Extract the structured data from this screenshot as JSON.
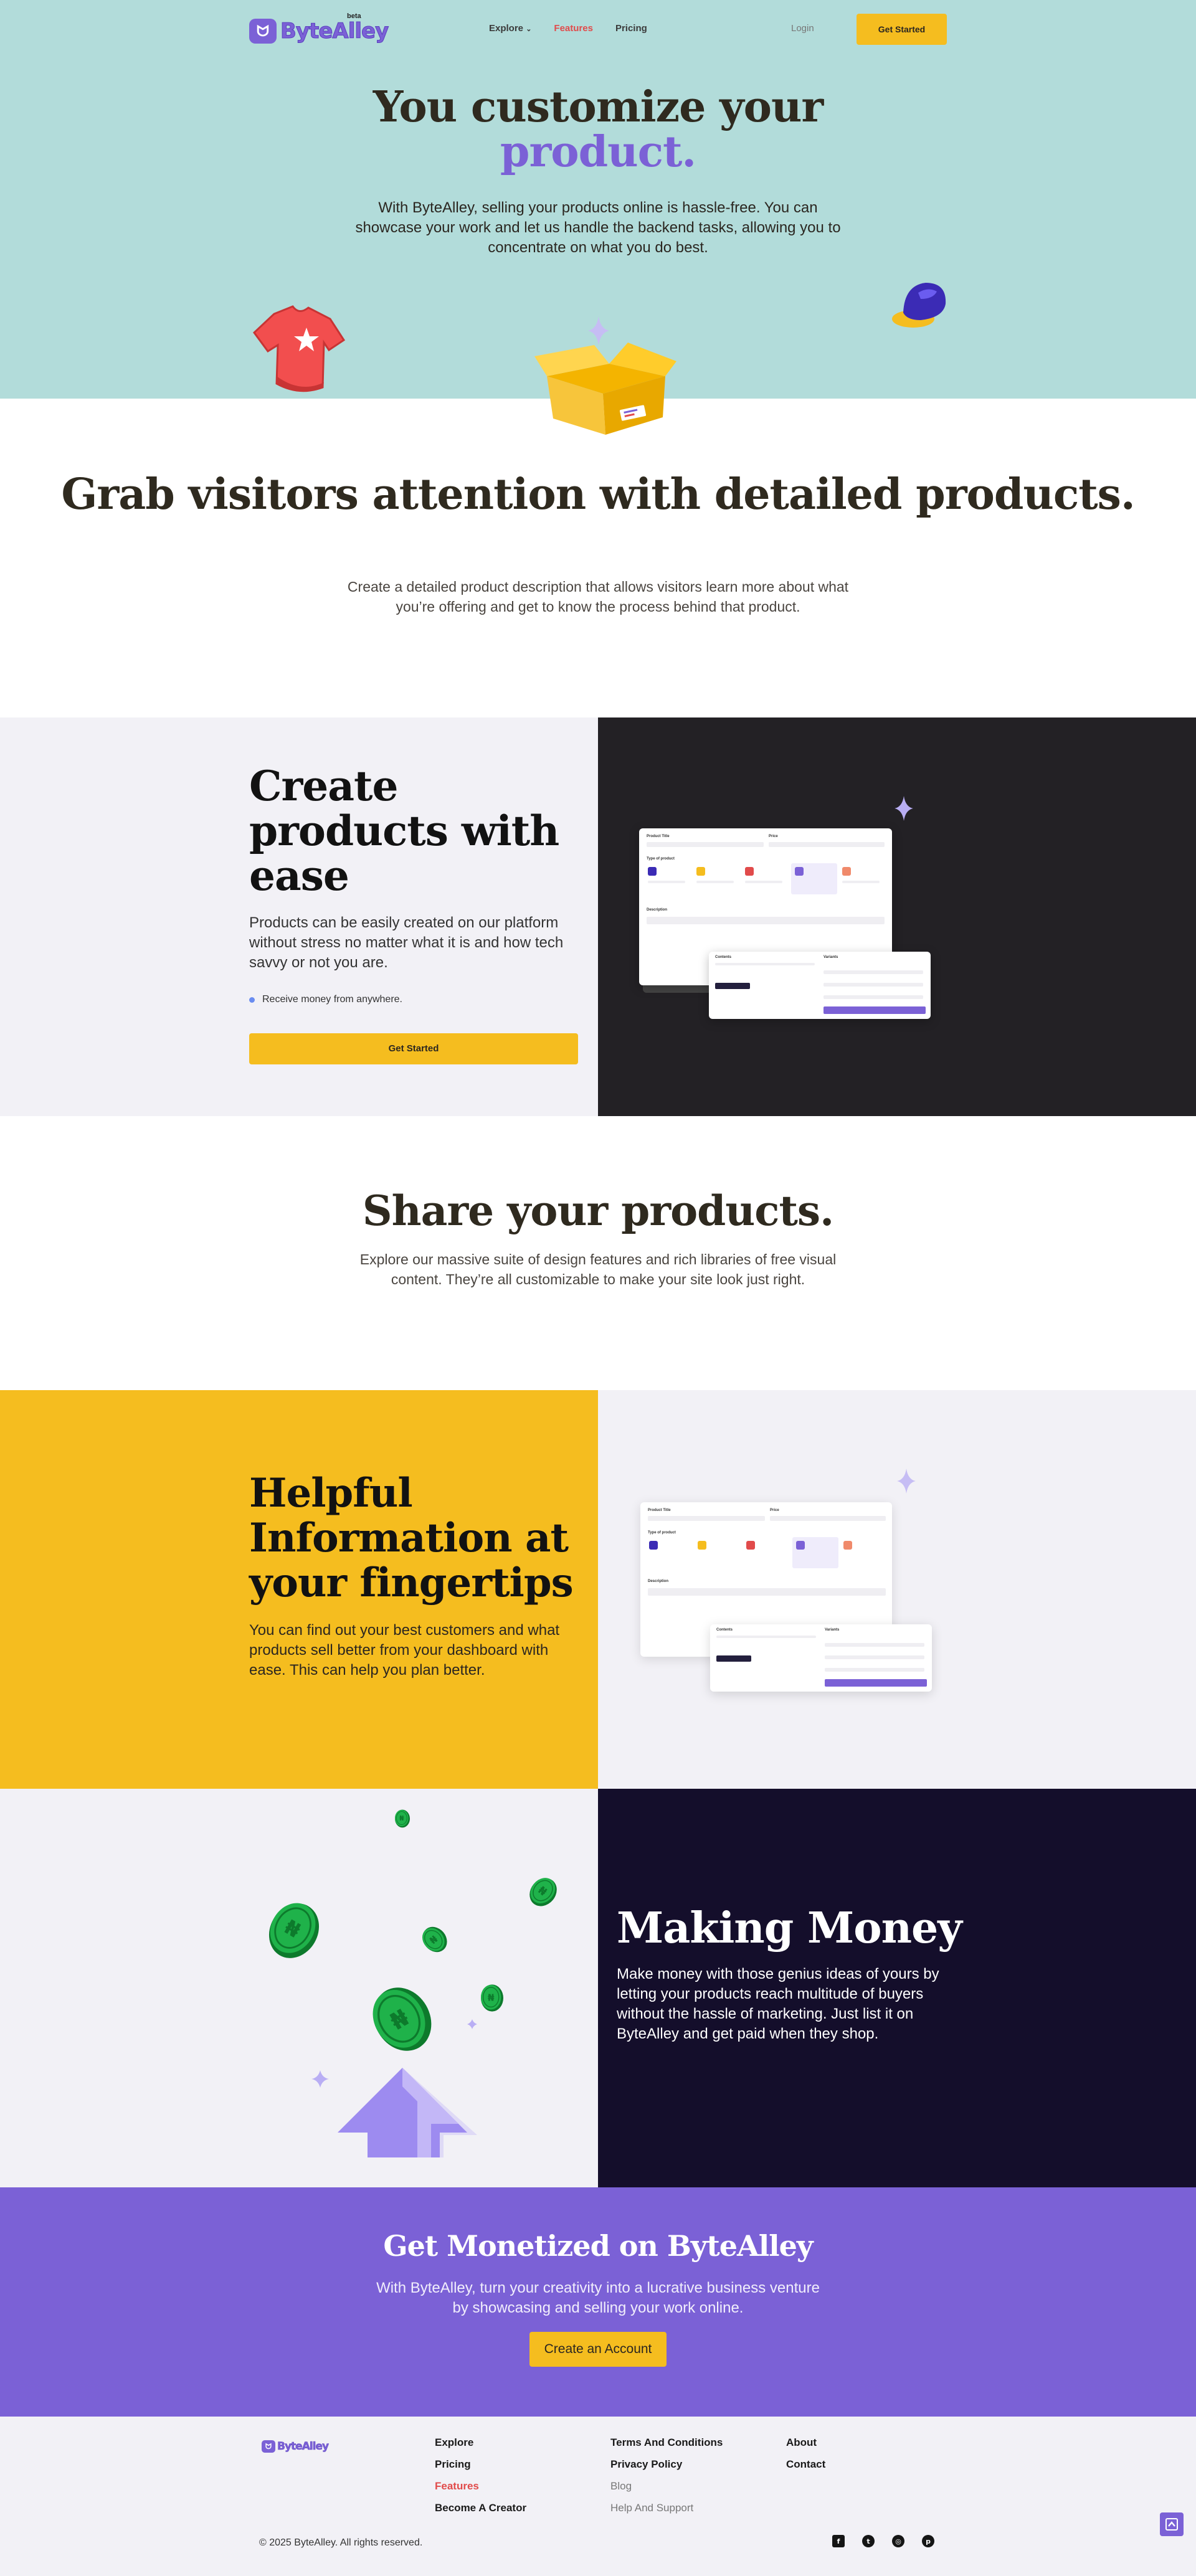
{
  "nav": {
    "logo_text": "ByteAlley",
    "beta": "beta",
    "links": [
      {
        "label": "Explore",
        "chevron": true
      },
      {
        "label": "Features",
        "active": true
      },
      {
        "label": "Pricing"
      }
    ],
    "login": "Login",
    "cta": "Get Started"
  },
  "hero": {
    "title_line1": "You customize your",
    "title_line2": "product.",
    "subtitle": "With ByteAlley, selling your products online is hassle-free. You can showcase your work and let us handle the backend tasks, allowing you to concentrate on what you do best."
  },
  "grab": {
    "title": "Grab visitors attention with detailed products.",
    "subtitle": "Create a detailed product description that allows visitors learn more about what you’re offering and get to know the process behind that product."
  },
  "create": {
    "title": "Create products with ease",
    "text": "Products can be easily created on our platform without stress no matter what it is and how tech savvy or not you are.",
    "bullet": "Receive money from anywhere.",
    "cta": "Get Started"
  },
  "share": {
    "title": "Share your products.",
    "subtitle": "Explore our massive suite of design features and rich libraries of free visual content. They’re all customizable to make your site look just right."
  },
  "helpful": {
    "title": "Helpful Information at your fingertips",
    "text": "You can find out your best customers and what products sell better from your dashboard with ease. This can help you plan better."
  },
  "money": {
    "title": "Making Money",
    "text": "Make money with those genius ideas of yours by letting your products reach multitude of buyers without the hassle of marketing. Just list it on ByteAlley and get paid when they shop."
  },
  "monetized": {
    "title": "Get Monetized on ByteAlley",
    "subtitle": "With ByteAlley, turn your creativity into a lucrative business venture by showcasing and selling your work online.",
    "cta": "Create an Account"
  },
  "footer": {
    "logo_text": "ByteAlley",
    "col1": [
      {
        "label": "Explore"
      },
      {
        "label": "Pricing"
      },
      {
        "label": "Features",
        "style": "red"
      },
      {
        "label": "Become A Creator"
      }
    ],
    "col2": [
      {
        "label": "Terms And Conditions"
      },
      {
        "label": "Privacy Policy"
      },
      {
        "label": "Blog",
        "style": "muted"
      },
      {
        "label": "Help And Support",
        "style": "muted"
      }
    ],
    "col3": [
      {
        "label": "About"
      },
      {
        "label": "Contact"
      }
    ],
    "copyright": "© 2025 ByteAlley. All rights reserved.",
    "socials": [
      "facebook-icon",
      "twitter-icon",
      "instagram-icon",
      "pinterest-icon"
    ]
  },
  "colors": {
    "hero_bg": "#b2dcda",
    "accent": "#7b61d6",
    "yellow": "#f5bd1f",
    "dark": "#232125",
    "navy": "#140e2b",
    "active_link": "#e14b4b"
  }
}
